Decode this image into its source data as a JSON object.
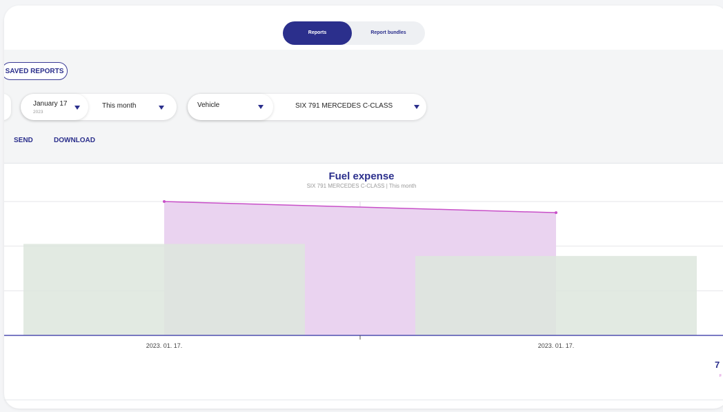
{
  "tabs": [
    {
      "label": "Reports",
      "active": true
    },
    {
      "label": "Report bundles",
      "active": false
    }
  ],
  "toolbar": {
    "saved_reports": "SAVED REPORTS",
    "send": "SEND",
    "download": "DOWNLOAD"
  },
  "filters": {
    "date": {
      "value": "January 17",
      "year": "2023"
    },
    "period": {
      "value": "This month"
    },
    "type": {
      "value": "Vehicle"
    },
    "vehicle": {
      "value": "SIX 791 MERCEDES C-CLASS"
    }
  },
  "colors": {
    "brand": "#2b2f8c",
    "line": "#c84fc8",
    "area": "#ead3f0",
    "bars": "#dde6dd"
  },
  "chart_data": {
    "type": "bar",
    "title": "Fuel expense",
    "subtitle": "SIX 791 MERCEDES C-CLASS | This month",
    "categories": [
      "2023. 01. 17.",
      "2023. 01. 17."
    ],
    "series": [
      {
        "kind": "bar",
        "values": [
          2.05,
          1.78
        ]
      },
      {
        "kind": "area-line",
        "values": [
          3.0,
          2.75
        ]
      }
    ],
    "ylim": [
      0,
      3.0
    ],
    "grid": true
  },
  "corner": {
    "number": "7",
    "tag": "F"
  }
}
